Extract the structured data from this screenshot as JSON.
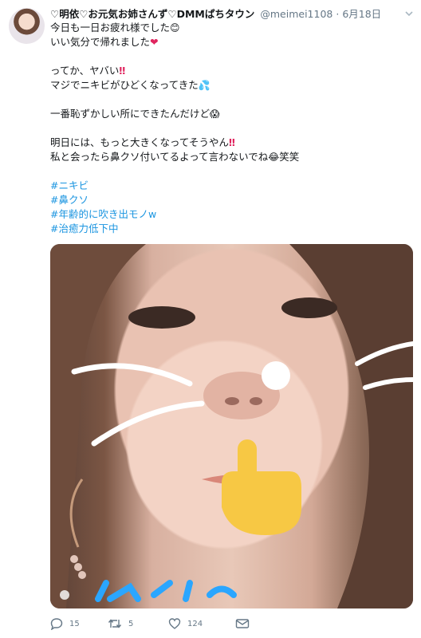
{
  "tweet": {
    "display_name": "♡明依♡お元気お姉さんず♡DMMぱちタウン",
    "handle": "@meimei1108",
    "separator": "·",
    "date": "6月18日",
    "lines": {
      "l1": "今日も一日お疲れ様でした",
      "l2": "いい気分で帰れました",
      "l3": "ってか、ヤバい",
      "l4": "マジでニキビがひどくなってきた",
      "l5": "一番恥ずかしい所にできたんだけど",
      "l6": "明日には、もっと大きくなってそうやん",
      "l7": "私と会ったら鼻クソ付いてるよって言わないでね",
      "l7_suffix": "笑笑"
    },
    "emojis": {
      "smile": "😊",
      "heart": "❤",
      "double_exclaim": "‼",
      "sweat": "💦",
      "scream": "😱",
      "laugh": "😂"
    },
    "hashtags": [
      "#ニキビ",
      "#鼻クソ",
      "#年齢的に吹き出モノw",
      "#治癒力低下中"
    ]
  },
  "actions": {
    "reply_count": "15",
    "retweet_count": "5",
    "like_count": "124"
  },
  "icons": [
    "caret-down-icon",
    "reply-icon",
    "retweet-icon",
    "like-icon",
    "dm-icon"
  ]
}
